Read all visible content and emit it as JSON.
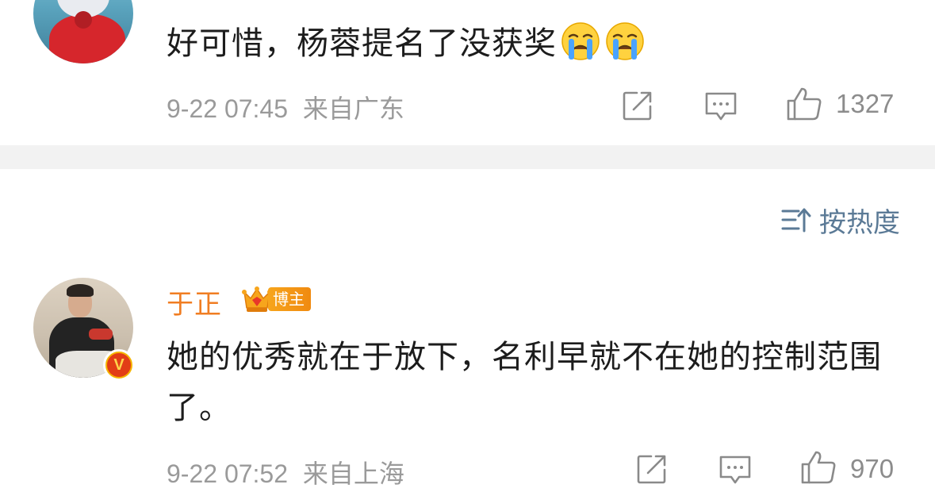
{
  "colors": {
    "time_text": "#9a9a9a",
    "count_text": "#8c8c8c",
    "icon_stroke": "#8a8a8a",
    "sort_accent": "#5b7a96",
    "username": "#f07d22",
    "badge_orange": "#f08a10",
    "divider": "#f2f2f2"
  },
  "comments": [
    {
      "avatar_icon": "avatar-image",
      "text": "好可惜，杨蓉提名了没获奖",
      "emojis": [
        "crying-face-emoji",
        "crying-face-emoji"
      ],
      "time": "9-22 07:45",
      "location": "来自广东",
      "likes": "1327",
      "actions": [
        "share-icon",
        "comment-icon",
        "like-icon"
      ]
    },
    {
      "avatar_icon": "avatar-image",
      "username": "于正",
      "badge_label": "博主",
      "verified_icon": "v-verified-badge",
      "text": "她的优秀就在于放下，名利早就不在她的控制范围了。",
      "time": "9-22 07:52",
      "location": "来自上海",
      "likes": "970",
      "actions": [
        "share-icon",
        "comment-icon",
        "like-icon"
      ]
    }
  ],
  "sort": {
    "icon": "sort-icon",
    "label": "按热度"
  }
}
